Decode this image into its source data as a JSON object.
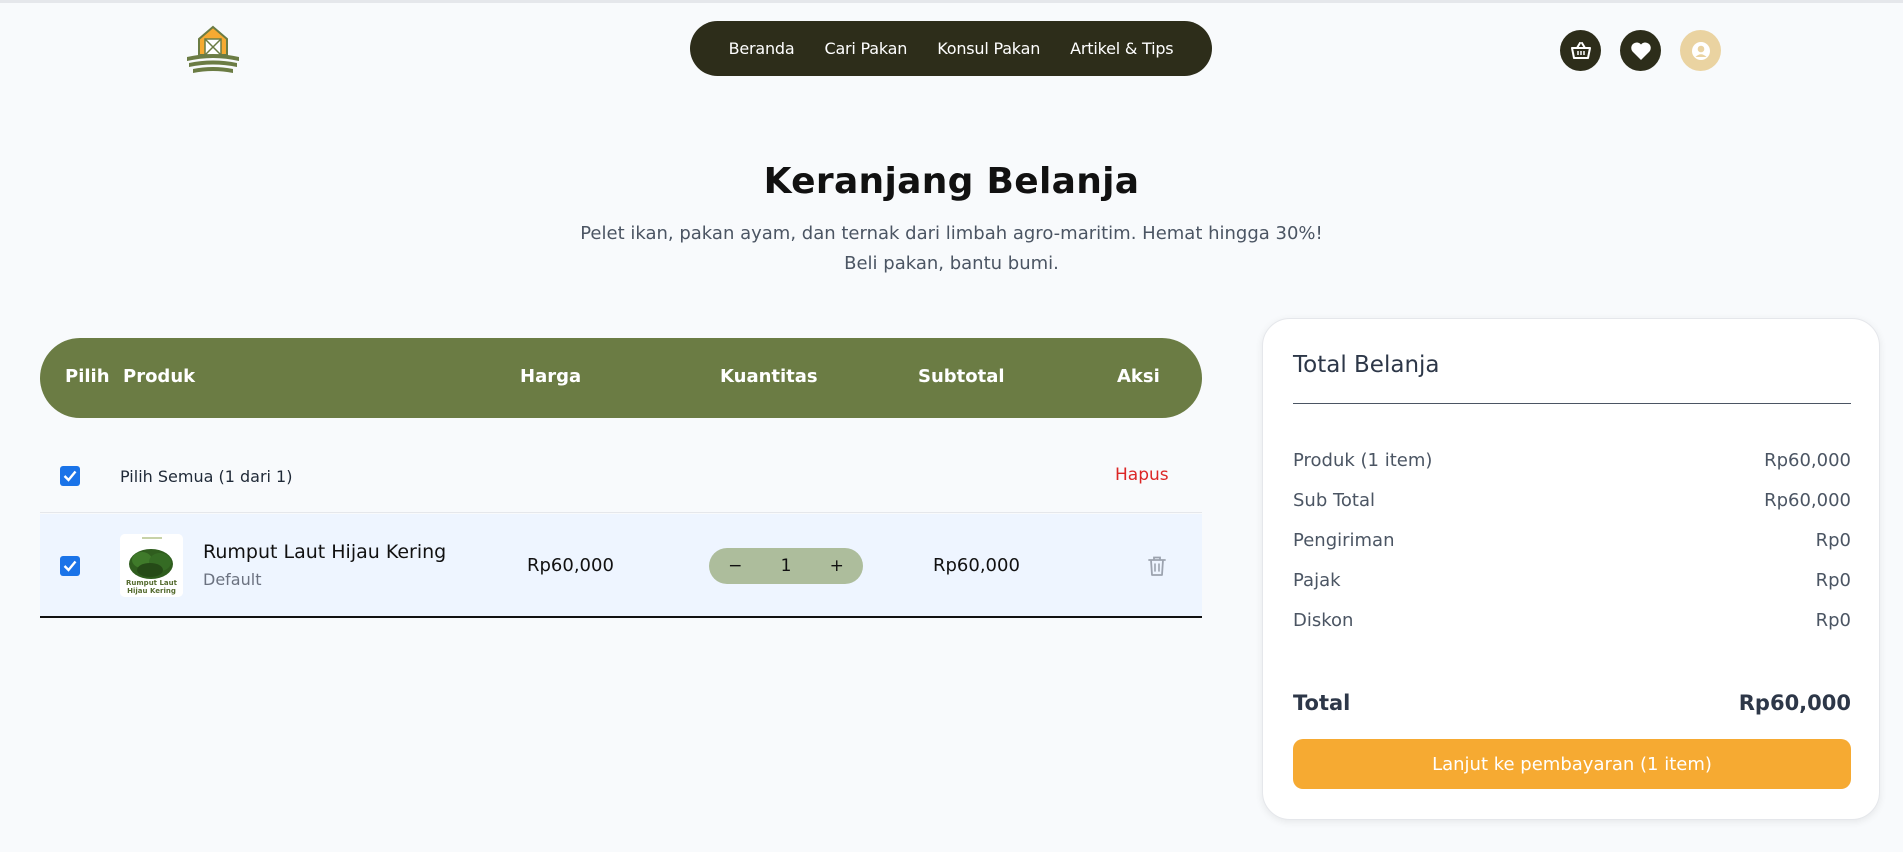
{
  "nav": {
    "items": [
      {
        "label": "Beranda"
      },
      {
        "label": "Cari Pakan"
      },
      {
        "label": "Konsul Pakan"
      },
      {
        "label": "Artikel & Tips"
      }
    ]
  },
  "header_icons": {
    "cart": "basket-icon",
    "wishlist": "heart-icon",
    "account": "user-icon"
  },
  "hero": {
    "title": "Keranjang Belanja",
    "subtitle_line1": "Pelet ikan, pakan ayam, dan ternak dari limbah agro-maritim. Hemat hingga 30%!",
    "subtitle_line2": "Beli pakan, bantu bumi."
  },
  "table": {
    "headers": [
      "Pilih",
      "Produk",
      "Harga",
      "Kuantitas",
      "Subtotal",
      "Aksi"
    ],
    "select_all_label": "Pilih Semua (1 dari 1)",
    "select_all_checked": true,
    "delete_label": "Hapus",
    "rows": [
      {
        "checked": true,
        "name": "Rumput Laut Hijau Kering",
        "variant": "Default",
        "thumb_text": "Rumput Laut Hijau Kering",
        "price": "Rp60,000",
        "quantity": "1",
        "subtotal": "Rp60,000"
      }
    ]
  },
  "summary": {
    "title": "Total Belanja",
    "lines": [
      {
        "label": "Produk (1 item)",
        "value": "Rp60,000"
      },
      {
        "label": "Sub Total",
        "value": "Rp60,000"
      },
      {
        "label": "Pengiriman",
        "value": "Rp0"
      },
      {
        "label": "Pajak",
        "value": "Rp0"
      },
      {
        "label": "Diskon",
        "value": "Rp0"
      }
    ],
    "total_label": "Total",
    "total_value": "Rp60,000",
    "checkout_label": "Lanjut ke pembayaran (1 item)"
  },
  "colors": {
    "nav_bg": "#2d2d1a",
    "table_header_bg": "#6b7c44",
    "stepper_bg": "#adbd9c",
    "checkout_bg": "#f6aa32",
    "danger": "#dc2626",
    "checkbox": "#1a73e8"
  }
}
